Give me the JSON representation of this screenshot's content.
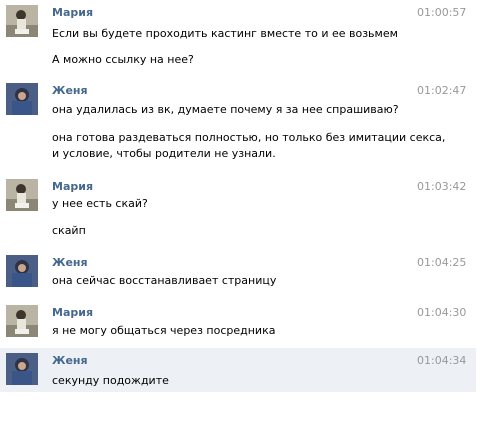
{
  "messages": [
    {
      "sender": "Мария",
      "time": "01:00:57",
      "avatar": "maria",
      "lines": [
        "Если вы будете проходить кастинг вместе то и ее возьмем",
        "А можно ссылку на нее?"
      ]
    },
    {
      "sender": "Женя",
      "time": "01:02:47",
      "avatar": "zhenya",
      "lines": [
        "она удалилась из вк, думаете почему я за нее спрашиваю?",
        "она готова раздеваться полностью, но только без имитации секса,",
        "и условие, чтобы родители не узнали."
      ]
    },
    {
      "sender": "Мария",
      "time": "01:03:42",
      "avatar": "maria",
      "lines": [
        "у нее есть скай?",
        "скайп"
      ]
    },
    {
      "sender": "Женя",
      "time": "01:04:25",
      "avatar": "zhenya",
      "lines": [
        "она сейчас восстанавливает страницу"
      ]
    },
    {
      "sender": "Мария",
      "time": "01:04:30",
      "avatar": "maria",
      "lines": [
        "я не могу общаться через посредника"
      ]
    },
    {
      "sender": "Женя",
      "time": "01:04:34",
      "avatar": "zhenya",
      "lines": [
        "секунду подождите"
      ]
    }
  ],
  "colors": {
    "sender_name": "#45688e",
    "timestamp": "#999999",
    "highlight_row": "#edf1f5"
  },
  "icons": {
    "maria": "avatar-photo",
    "zhenya": "avatar-photo"
  }
}
